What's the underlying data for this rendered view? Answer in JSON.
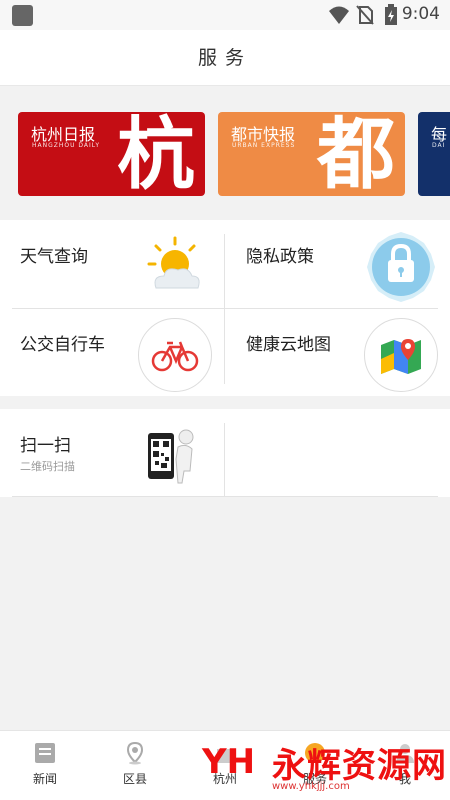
{
  "status": {
    "time": "9:04"
  },
  "header": {
    "title": "服务"
  },
  "banner": [
    {
      "name": "杭州日报",
      "sub": "HANGZHOU DAILY",
      "big": "杭",
      "color": "#c40d14"
    },
    {
      "name": "都市快报",
      "sub": "URBAN EXPRESS",
      "big": "都",
      "color": "#ef8b45"
    },
    {
      "name": "每",
      "sub": "DAI",
      "big": "",
      "color": "#13306a"
    }
  ],
  "services": [
    {
      "label": "天气查询",
      "icon": "weather-icon"
    },
    {
      "label": "隐私政策",
      "icon": "lock-icon"
    },
    {
      "label": "公交自行车",
      "icon": "bicycle-icon"
    },
    {
      "label": "健康云地图",
      "icon": "map-icon"
    }
  ],
  "scan": {
    "label": "扫一扫",
    "sub": "二维码扫描",
    "icon": "qr-phone-icon"
  },
  "nav": [
    {
      "label": "新闻",
      "icon": "news-icon"
    },
    {
      "label": "区县",
      "icon": "location-icon"
    },
    {
      "label": "杭州",
      "icon": "city-icon"
    },
    {
      "label": "服务",
      "icon": "service-icon"
    },
    {
      "label": "我",
      "icon": "profile-icon"
    }
  ],
  "watermark": {
    "text": "永辉资源网",
    "url": "www.yhkjjj.com"
  }
}
